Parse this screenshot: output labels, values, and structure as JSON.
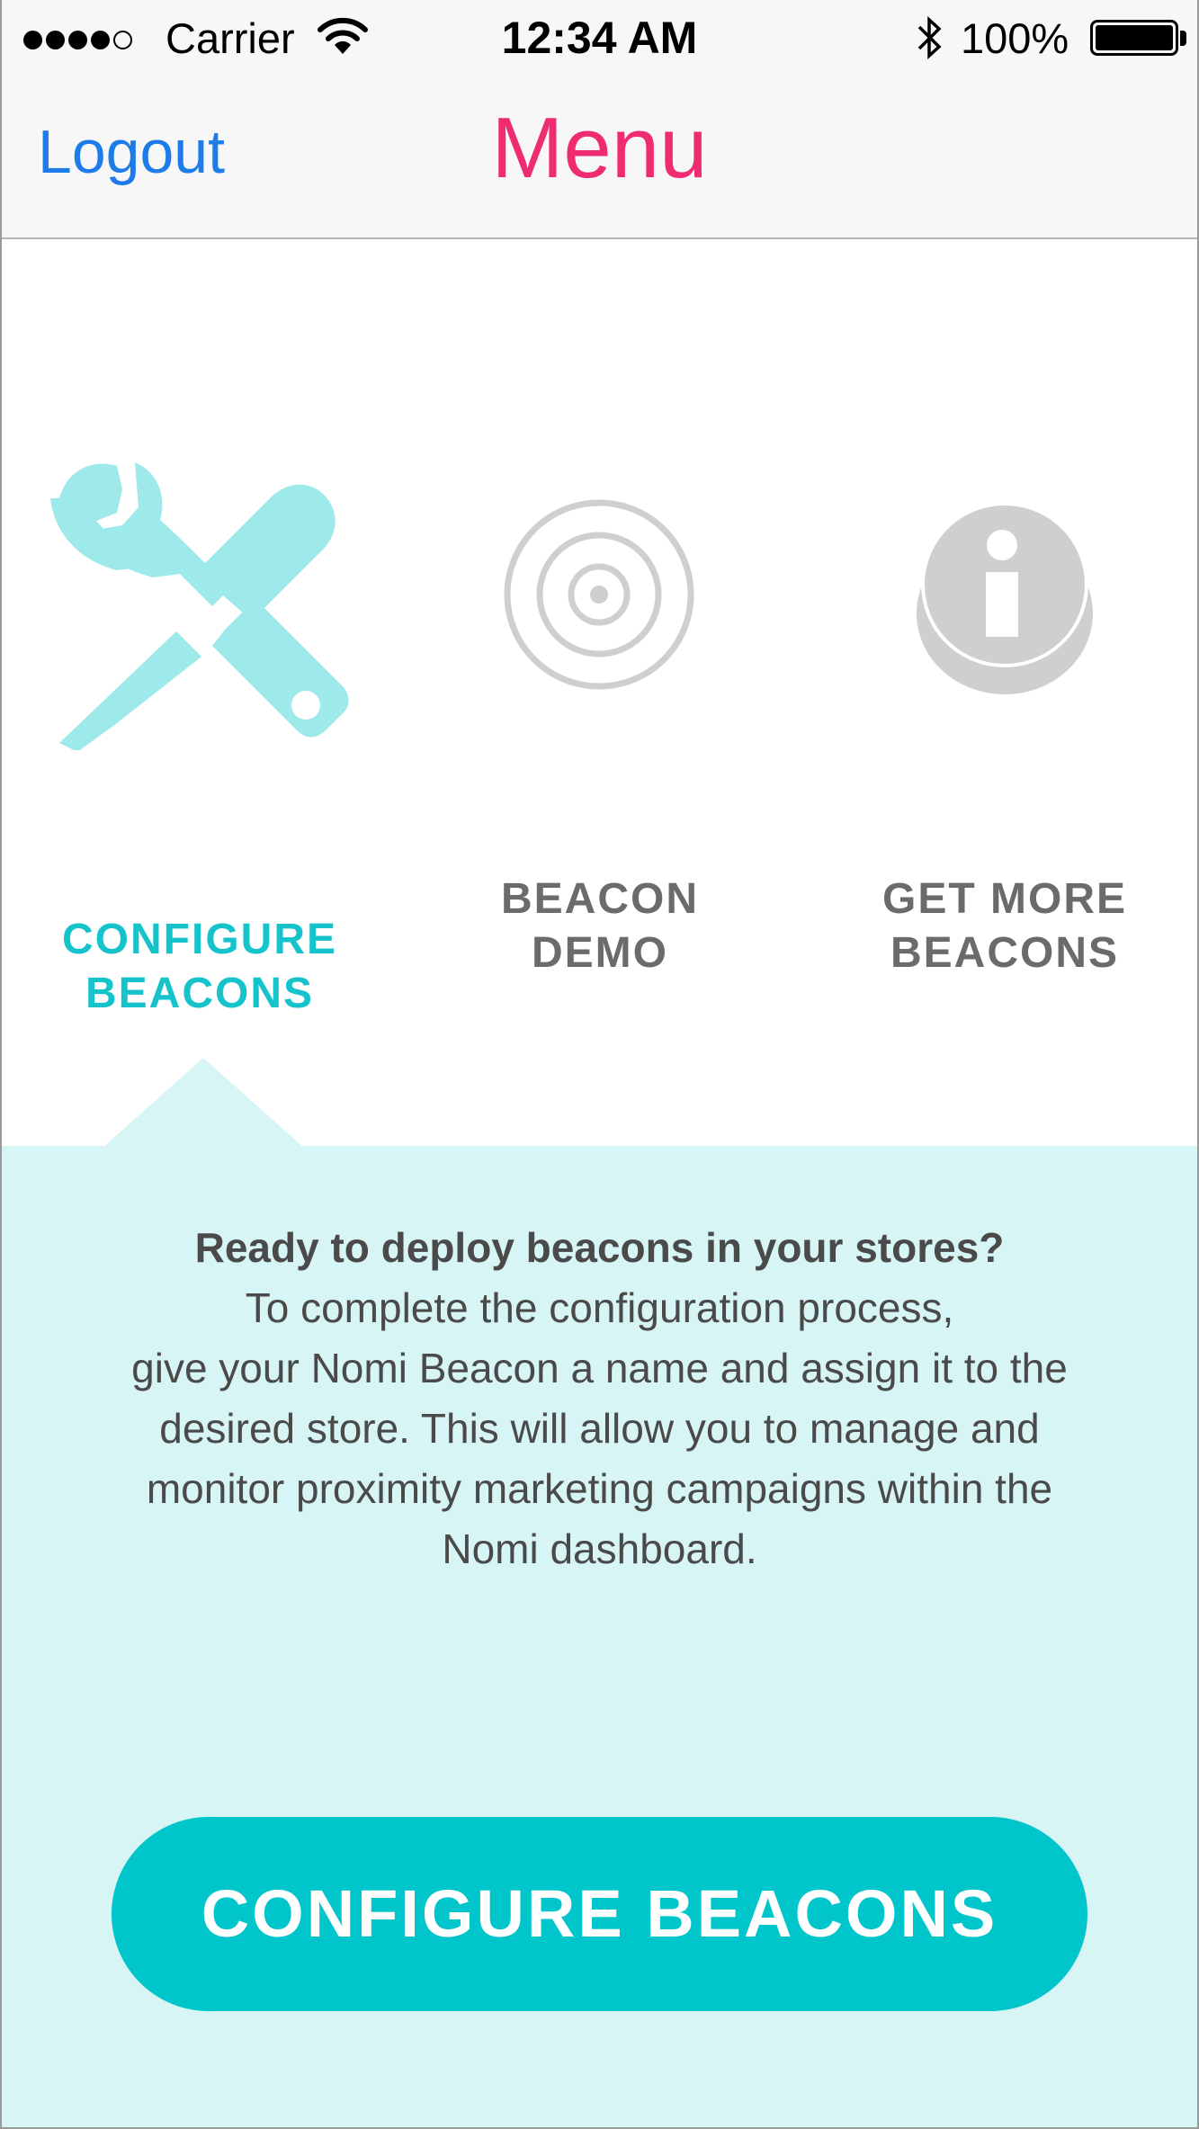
{
  "status_bar": {
    "carrier": "Carrier",
    "time": "12:34 AM",
    "battery": "100%",
    "battery_level": 1.0,
    "signal_bars_filled": 4,
    "signal_bars_total": 5
  },
  "nav": {
    "logout_label": "Logout",
    "title": "Menu",
    "title_color": "#ef2b71",
    "link_color": "#1e7ce8"
  },
  "menu": {
    "options": [
      {
        "id": "configure",
        "label_line1": "CONFIGURE",
        "label_line2": "BEACONS",
        "icon": "tools-icon",
        "selected": true,
        "color": "#17c3cb"
      },
      {
        "id": "demo",
        "label_line1": "BEACON",
        "label_line2": "DEMO",
        "icon": "target-icon",
        "selected": false,
        "color": "#6b6b6b"
      },
      {
        "id": "more",
        "label_line1": "GET MORE",
        "label_line2": "BEACONS",
        "icon": "info-icon",
        "selected": false,
        "color": "#6b6b6b"
      }
    ]
  },
  "panel": {
    "heading": "Ready to deploy beacons in your stores?",
    "body_line1": "To complete the configuration process,",
    "body_line2": "give your Nomi Beacon a name and assign it to the",
    "body_line3": "desired store. This will allow you to manage and",
    "body_line4": "monitor proximity marketing campaigns within the",
    "body_line5": "Nomi dashboard.",
    "background": "#d8f5f5",
    "button_label": "CONFIGURE BEACONS",
    "button_color": "#00c6cc"
  }
}
